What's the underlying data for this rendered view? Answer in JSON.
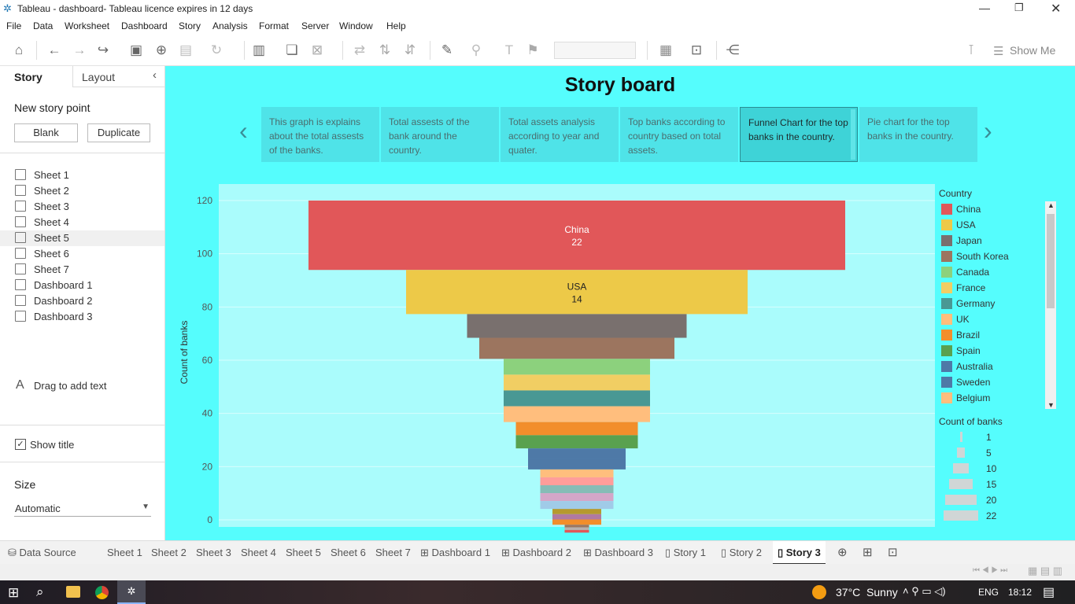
{
  "window": {
    "title": "Tableau - dashboard- Tableau licence expires in 12 days"
  },
  "menu": [
    "File",
    "Data",
    "Worksheet",
    "Dashboard",
    "Story",
    "Analysis",
    "Format",
    "Server",
    "Window",
    "Help"
  ],
  "toolbar": {
    "show_me": "Show Me"
  },
  "left": {
    "tab_story": "Story",
    "tab_layout": "Layout",
    "new_story_point": "New story point",
    "blank": "Blank",
    "duplicate": "Duplicate",
    "sheets": [
      "Sheet 1",
      "Sheet 2",
      "Sheet 3",
      "Sheet 4",
      "Sheet 5",
      "Sheet 6",
      "Sheet 7",
      "Dashboard 1",
      "Dashboard 2",
      "Dashboard 3"
    ],
    "drag_text": "Drag to add text",
    "show_title": "Show title",
    "size_label": "Size",
    "size_value": "Automatic"
  },
  "story": {
    "title": "Story board",
    "points": [
      "This graph is explains about the total assests of the banks.",
      "Total assests of the bank around the country.",
      "Total assets analysis according to year and quater.",
      "Top banks according to country based on total assets.",
      "Funnel Chart for the top banks in the country.",
      "Pie chart for the top banks in the country."
    ],
    "active_point": 4
  },
  "chart_data": {
    "type": "bar",
    "ylabel": "Count of banks",
    "ylim": [
      0,
      120
    ],
    "yticks": [
      0,
      20,
      40,
      60,
      80,
      100,
      120
    ],
    "series": [
      {
        "name": "China",
        "value": 22,
        "color": "#e15759"
      },
      {
        "name": "USA",
        "value": 14,
        "color": "#edc948"
      },
      {
        "name": "Japan",
        "value": 9,
        "color": "#79706e"
      },
      {
        "name": "South Korea",
        "value": 8,
        "color": "#9c755f"
      },
      {
        "name": "Canada",
        "value": 6,
        "color": "#8cd17d"
      },
      {
        "name": "France",
        "value": 6,
        "color": "#f1ce63"
      },
      {
        "name": "Germany",
        "value": 6,
        "color": "#499894"
      },
      {
        "name": "UK",
        "value": 6,
        "color": "#ffbe7d"
      },
      {
        "name": "Brazil",
        "value": 5,
        "color": "#f28e2b"
      },
      {
        "name": "Spain",
        "value": 5,
        "color": "#59a14f"
      },
      {
        "name": "Australia",
        "value": 4,
        "color": "#4e79a7"
      },
      {
        "name": "Sweden",
        "value": 4,
        "color": "#4e79a7"
      },
      {
        "name": "Belgium",
        "value": 3,
        "color": "#ffbe7d"
      },
      {
        "name": "",
        "value": 3,
        "color": "#ff9d9a"
      },
      {
        "name": "",
        "value": 3,
        "color": "#86bcb6"
      },
      {
        "name": "",
        "value": 3,
        "color": "#d4a6c8"
      },
      {
        "name": "",
        "value": 3,
        "color": "#a0cbe8"
      },
      {
        "name": "",
        "value": 2,
        "color": "#b6992d"
      },
      {
        "name": "",
        "value": 2,
        "color": "#b07aa1"
      },
      {
        "name": "",
        "value": 2,
        "color": "#f28e2b"
      },
      {
        "name": "",
        "value": 1,
        "color": "#9d7660"
      },
      {
        "name": "",
        "value": 1,
        "color": "#bab0ac"
      },
      {
        "name": "",
        "value": 1,
        "color": "#e15759"
      }
    ],
    "labels": [
      {
        "name": "China",
        "value": "22"
      },
      {
        "name": "USA",
        "value": "14"
      }
    ]
  },
  "legend": {
    "country_title": "Country",
    "countries": [
      {
        "name": "China",
        "color": "#e15759"
      },
      {
        "name": "USA",
        "color": "#edc948"
      },
      {
        "name": "Japan",
        "color": "#79706e"
      },
      {
        "name": "South Korea",
        "color": "#9c755f"
      },
      {
        "name": "Canada",
        "color": "#8cd17d"
      },
      {
        "name": "France",
        "color": "#f1ce63"
      },
      {
        "name": "Germany",
        "color": "#499894"
      },
      {
        "name": "UK",
        "color": "#ffbe7d"
      },
      {
        "name": "Brazil",
        "color": "#f28e2b"
      },
      {
        "name": "Spain",
        "color": "#59a14f"
      },
      {
        "name": "Australia",
        "color": "#4e79a7"
      },
      {
        "name": "Sweden",
        "color": "#4e79a7"
      },
      {
        "name": "Belgium",
        "color": "#ffbe7d"
      }
    ],
    "size_title": "Count of banks",
    "sizes": [
      "1",
      "5",
      "10",
      "15",
      "20",
      "22"
    ]
  },
  "tabs": {
    "data_source": "Data Source",
    "items": [
      "Sheet 1",
      "Sheet 2",
      "Sheet 3",
      "Sheet 4",
      "Sheet 5",
      "Sheet 6",
      "Sheet 7",
      "Dashboard 1",
      "Dashboard 2",
      "Dashboard 3",
      "Story 1",
      "Story 2",
      "Story 3"
    ],
    "active": "Story 3"
  },
  "taskbar": {
    "weather": "37°C  Sunny",
    "lang": "ENG",
    "time": "18:12"
  }
}
